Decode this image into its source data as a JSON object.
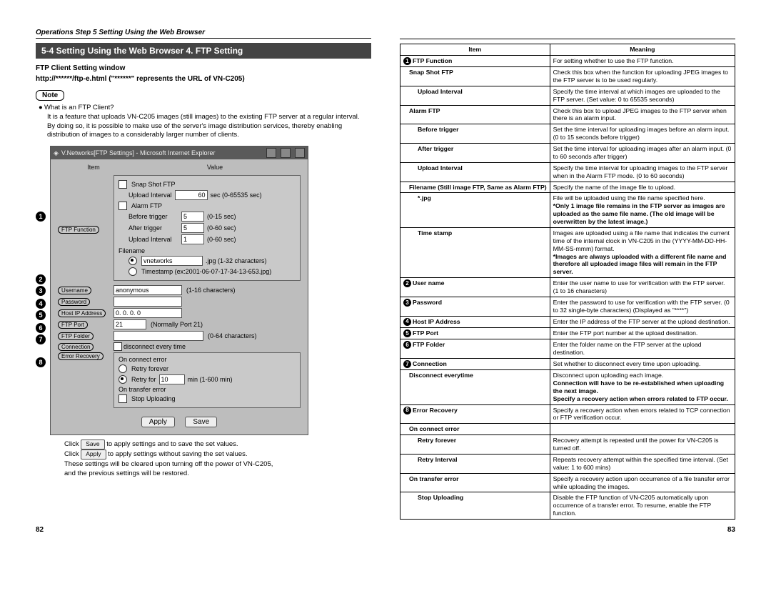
{
  "left": {
    "crumb": "Operations Step 5 Setting Using the Web Browser",
    "section": "5-4 Setting Using the Web Browser 4. FTP Setting",
    "sub1": "FTP Client Setting window",
    "sub2": "http://******/ftp-e.html (\"******\" represents the URL of VN-C205)",
    "note_label": "Note",
    "note_q": "What is an FTP Client?",
    "note_p1": "It is a feature that uploads VN-C205 images (still images) to the existing FTP server at a regular interval.",
    "note_p2": "By doing so, it is possible to make use of the server's image distribution services, thereby enabling distribution of images to a considerably larger number of clients.",
    "win_title": "V.Networks[FTP Settings] - Microsoft Internet Explorer",
    "col_item": "Item",
    "col_value": "Value",
    "lbl_ftp_function": "FTP Function",
    "lbl_username": "Username",
    "lbl_password": "Password",
    "lbl_hostip": "Host IP Address",
    "lbl_ftpport": "FTP Port",
    "lbl_ftpfolder": "FTP Folder",
    "lbl_connection": "Connection",
    "lbl_error": "Error Recovery",
    "snap": "Snap Shot FTP",
    "upl_int": "Upload Interval",
    "upl_int_val": "60",
    "upl_int_hint": "sec (0-65535 sec)",
    "alarm": "Alarm FTP",
    "before": "Before trigger",
    "before_val": "5",
    "before_hint": "(0-15 sec)",
    "after": "After trigger",
    "after_val": "5",
    "after_hint": "(0-60 sec)",
    "upl2": "Upload Interval",
    "upl2_val": "1",
    "upl2_hint": "(0-60 sec)",
    "filename_lbl": "Filename",
    "filename_val": "vnetworks",
    "filename_hint": ".jpg (1-32 characters)",
    "timestamp": "Timestamp (ex:2001-06-07-17-34-13-653.jpg)",
    "user_val": "anonymous",
    "user_hint": "(1-16 characters)",
    "host_val": "0. 0. 0. 0",
    "port_val": "21",
    "port_hint": "(Normally Port 21)",
    "folder_hint": "(0-64 characters)",
    "disc": "disconnect every time",
    "onconn": "On connect error",
    "retry_forever": "Retry forever",
    "retry_for": "Retry for",
    "retry_val": "10",
    "retry_hint": "min (1-600 min)",
    "ontrans": "On transfer error",
    "stopup": "Stop Uploading",
    "btn_apply": "Apply",
    "btn_save": "Save",
    "cap1a": "Click ",
    "cap1b": " to apply settings and to save the set values.",
    "cap2a": "Click ",
    "cap2b": " to apply settings without saving the set values.",
    "cap3": "These settings will be cleared upon turning off the power of VN-C205,",
    "cap4": "and the previous settings will be restored.",
    "pagenum": "82"
  },
  "right": {
    "head_item": "Item",
    "head_meaning": "Meaning",
    "r": [
      {
        "n": "1",
        "item": "FTP Function",
        "mean": "For setting whether to use the FTP function."
      },
      {
        "item": "Snap Shot FTP",
        "sub": 1,
        "mean": "Check this box when the function for uploading JPEG images to the FTP server is to be used regularly."
      },
      {
        "item": "Upload Interval",
        "sub": 2,
        "mean": "Specify the time interval at which images are uploaded to the FTP server. (Set value: 0 to 65535 seconds)"
      },
      {
        "item": "Alarm FTP",
        "sub": 1,
        "mean": "Check this box to upload JPEG images to the FTP server when there is an alarm input."
      },
      {
        "item": "Before trigger",
        "sub": 2,
        "mean": "Set the time interval for uploading images before an alarm input. (0 to 15 seconds before trigger)"
      },
      {
        "item": "After trigger",
        "sub": 2,
        "mean": "Set the time interval for uploading images after an alarm input. (0 to 60 seconds after trigger)"
      },
      {
        "item": "Upload Interval",
        "sub": 2,
        "mean": "Specify the time interval for uploading images to the FTP server when in the Alarm FTP mode. (0 to 60 seconds)"
      },
      {
        "item": "Filename (Still image FTP, Same as Alarm FTP)",
        "sub": 1,
        "mean": "Specify the name of the image file to upload."
      },
      {
        "item": "*.jpg",
        "sub": 2,
        "mean": "File will be uploaded using the file name specified here.\n*Only 1 image file remains in the FTP server as images are uploaded as the same file name. (The old image will be overwritten by the latest image.)",
        "bold2": true
      },
      {
        "item": "Time stamp",
        "sub": 2,
        "mean": "Images are uploaded using a file name that indicates the current time of the internal clock in VN-C205 in the (YYYY-MM-DD-HH-MM-SS-mmm) format.\n*Images are always uploaded with a different file name and therefore all uploaded image files will remain in the FTP server.",
        "bold2": true
      },
      {
        "n": "2",
        "item": "User name",
        "mean": "Enter the user name to use for verification with the FTP server. (1 to 16 characters)"
      },
      {
        "n": "3",
        "item": "Password",
        "mean": "Enter the password to use for verification with the FTP server. (0 to 32 single-byte characters) (Displayed as \"****\")"
      },
      {
        "n": "4",
        "item": "Host IP Address",
        "mean": "Enter the IP address of the FTP server at the upload destination."
      },
      {
        "n": "5",
        "item": "FTP Port",
        "mean": "Enter the FTP port number at the upload destination."
      },
      {
        "n": "6",
        "item": "FTP Folder",
        "mean": "Enter the folder name on the FTP server at the upload destination."
      },
      {
        "n": "7",
        "item": "Connection",
        "mean": "Set whether to disconnect every time upon uploading."
      },
      {
        "item": "Disconnect everytime",
        "sub": 1,
        "mean": "Disconnect upon uploading each image.\nConnection will have to be re-established when uploading the next image.\nSpecify a recovery action when errors related to FTP occur.",
        "bold3": true
      },
      {
        "n": "8",
        "item": "Error Recovery",
        "mean": "Specify a recovery action when errors related to TCP connection or FTP verification occur."
      },
      {
        "item": "On connect error",
        "sub": 1,
        "mean": ""
      },
      {
        "item": "Retry forever",
        "sub": 2,
        "mean": "Recovery attempt is repeated until the power for VN-C205 is turned off."
      },
      {
        "item": "Retry Interval",
        "sub": 2,
        "mean": "Repeats recovery attempt within the specified time interval. (Set value: 1 to 600 mins)"
      },
      {
        "item": "On transfer error",
        "sub": 1,
        "mean": "Specify a recovery action upon occurrence of  a file transfer error while uploading the images."
      },
      {
        "item": "Stop Uploading",
        "sub": 2,
        "mean": "Disable the FTP function of VN-C205 automatically upon occurrence of a transfer error. To resume, enable the FTP function."
      }
    ],
    "pagenum": "83"
  }
}
